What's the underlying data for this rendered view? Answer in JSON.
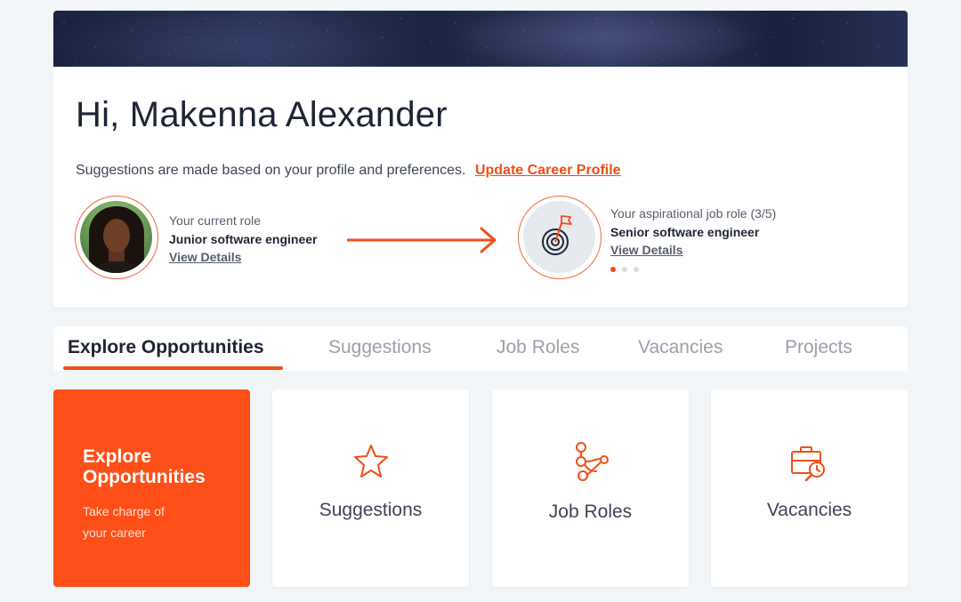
{
  "profile": {
    "greeting": "Hi, Makenna Alexander",
    "suggestion_text": "Suggestions are made based on your profile and preferences.",
    "update_link": "Update Career Profile",
    "current": {
      "caption": "Your current role",
      "role": "Junior software engineer",
      "details_link": "View Details"
    },
    "target": {
      "caption": "Your aspirational job role (3/5)",
      "role": "Senior software engineer",
      "details_link": "View Details",
      "carousel_active_index": 0,
      "carousel_dots": 3
    }
  },
  "tabs": [
    {
      "label": "Explore Opportunities",
      "active": true
    },
    {
      "label": "Suggestions",
      "active": false
    },
    {
      "label": "Job Roles",
      "active": false
    },
    {
      "label": "Vacancies",
      "active": false
    },
    {
      "label": "Projects",
      "active": false
    }
  ],
  "cards": {
    "featured": {
      "title": "Explore\nOpportunities",
      "title_line1": "Explore",
      "title_line2": "Opportunities",
      "subtitle_line1": "Take charge of",
      "subtitle_line2": "your career"
    },
    "items": [
      {
        "label": "Suggestions",
        "icon": "star-icon"
      },
      {
        "label": "Job Roles",
        "icon": "career-path-icon"
      },
      {
        "label": "Vacancies",
        "icon": "briefcase-search-icon"
      }
    ]
  },
  "colors": {
    "accent": "#fe4f18",
    "link": "#f04e16",
    "text": "#1d2433",
    "muted": "#9aa0aa"
  }
}
